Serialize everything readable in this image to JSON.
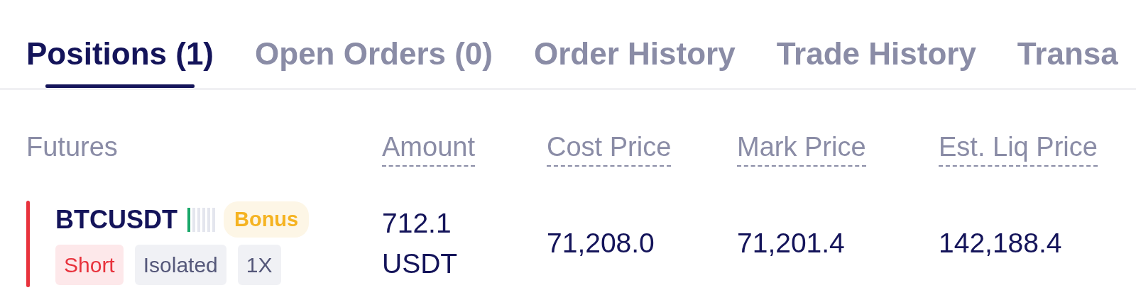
{
  "tabs": [
    {
      "label": "Positions (1)",
      "selected": true
    },
    {
      "label": "Open Orders (0)",
      "selected": false
    },
    {
      "label": "Order History",
      "selected": false
    },
    {
      "label": "Trade History",
      "selected": false
    },
    {
      "label": "Transa",
      "selected": false
    }
  ],
  "table": {
    "columns": [
      {
        "label": "Futures",
        "dotted": false
      },
      {
        "label": "Amount",
        "dotted": true
      },
      {
        "label": "Cost Price",
        "dotted": true
      },
      {
        "label": "Mark Price",
        "dotted": true
      },
      {
        "label": "Est. Liq Price",
        "dotted": true
      }
    ],
    "rows": [
      {
        "symbol": "BTCUSDT",
        "risk": {
          "level": 0.17
        },
        "badge": "Bonus",
        "tags": [
          {
            "label": "Short",
            "kind": "short"
          },
          {
            "label": "Isolated",
            "kind": "plain"
          },
          {
            "label": "1X",
            "kind": "plain"
          }
        ],
        "amount": [
          "712.1",
          "USDT"
        ],
        "cost_price": "71,208.0",
        "mark_price": "71,201.4",
        "liq_price": "142,188.4"
      }
    ]
  }
}
